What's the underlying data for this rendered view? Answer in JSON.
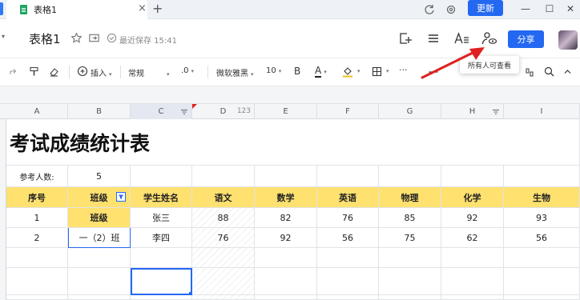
{
  "window": {
    "tab_title": "表格1",
    "tab_close": "×",
    "new_tab": "+",
    "update_label": "更新",
    "minimize": "—",
    "maximize": "☐",
    "close": "✕"
  },
  "doc": {
    "title": "表格1",
    "save_status": "最近保存 15:41",
    "share_label": "分享"
  },
  "toolbar": {
    "insert_label": "插入",
    "format_value": "常规",
    "decimal_label": ".0",
    "font_family": "微软雅黑",
    "font_size": "10",
    "bold_label": "B",
    "font_color_label": "A",
    "more_label": "···"
  },
  "tooltip": {
    "text": "所有人可查看"
  },
  "colors": {
    "accent": "#2468f2",
    "header_fill": "#ffe170",
    "arrow": "#e02020",
    "selected_border": "#2468f2"
  },
  "sheet": {
    "columns": [
      "A",
      "B",
      "C",
      "D",
      "E",
      "F",
      "G",
      "H",
      "I"
    ],
    "column_d_badge": "123",
    "title": "考试成绩统计表",
    "participants_label": "参考人数:",
    "participants_value": "5",
    "headers": [
      "序号",
      "班级",
      "学生姓名",
      "语文",
      "数学",
      "英语",
      "物理",
      "化学",
      "生物"
    ],
    "rows": [
      [
        "1",
        "班级",
        "张三",
        "88",
        "82",
        "76",
        "85",
        "92",
        "93"
      ],
      [
        "2",
        "一（2）班",
        "李四",
        "76",
        "92",
        "56",
        "75",
        "62",
        "56"
      ]
    ]
  }
}
